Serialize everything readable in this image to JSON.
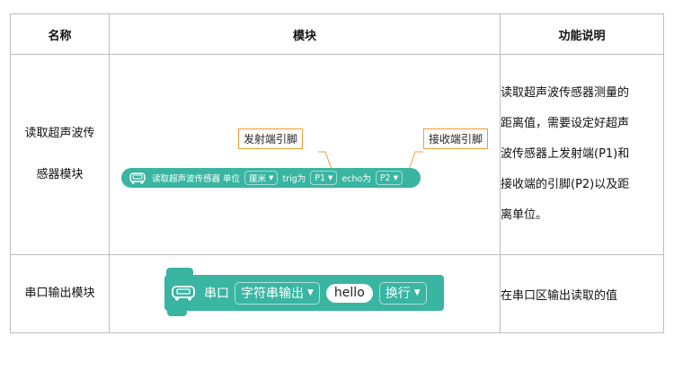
{
  "table": {
    "headers": {
      "name": "名称",
      "module": "模块",
      "desc": "功能说明"
    },
    "row1": {
      "name_line1": "读取超声波传",
      "name_line2": "感器模块",
      "desc": [
        "读取超声波传感器测量的",
        "距离值，需要设定好超声",
        "波传感器上发射端(P1)和",
        "接收端的引脚(P2)以及距",
        "离单位。"
      ],
      "block": {
        "label": "读取超声波传感器 单位",
        "unit": "厘米",
        "trig_label": "trig为",
        "trig_value": "P1",
        "echo_label": "echo为",
        "echo_value": "P2"
      },
      "callout_trig": "发射端引脚",
      "callout_echo": "接收端引脚"
    },
    "row2": {
      "name": "串口输出模块",
      "desc": "在串口区输出读取的值",
      "block": {
        "label": "串口",
        "mode": "字符串输出",
        "text": "hello",
        "newline": "换行"
      }
    }
  },
  "colors": {
    "block": "#39b5a2",
    "callout_border": "#f39c32",
    "grid": "#bdbdbd"
  },
  "icons": {
    "block_icon": "car-icon",
    "dropdown": "caret-down-icon"
  }
}
